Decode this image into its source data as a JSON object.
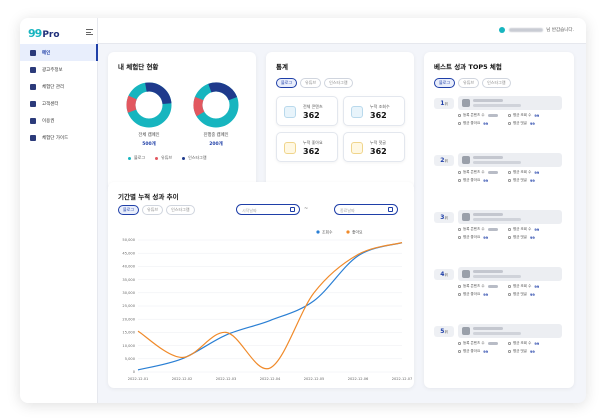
{
  "logo": {
    "num": "99",
    "pro": "Pro"
  },
  "nav": [
    {
      "label": "메인",
      "icon": "home-icon",
      "active": true
    },
    {
      "label": "광고주정보",
      "icon": "document-icon",
      "active": false
    },
    {
      "label": "체험단 관리",
      "icon": "users-icon",
      "active": false
    },
    {
      "label": "고객센터",
      "icon": "headset-icon",
      "active": false
    },
    {
      "label": "이용권",
      "icon": "ticket-icon",
      "active": false
    },
    {
      "label": "체험단 가이드",
      "icon": "book-icon",
      "active": false
    }
  ],
  "user": {
    "suffix": "님 반갑습니다."
  },
  "status": {
    "title": "내 체험단 현황",
    "donut1": {
      "label": "전체 캠페인",
      "value": "500개"
    },
    "donut2": {
      "label": "진행중 캠페인",
      "value": "200개"
    },
    "legend": [
      "블로그",
      "유튜브",
      "인스타그램"
    ]
  },
  "stats": {
    "title": "통계",
    "tabs": [
      "블로그",
      "유튜브",
      "인스타그램"
    ],
    "items": [
      {
        "label": "전체 콘텐츠",
        "value": "362",
        "icon": "content-icon"
      },
      {
        "label": "누적 조회수",
        "value": "362",
        "icon": "views-icon"
      },
      {
        "label": "누적 좋아요",
        "value": "362",
        "icon": "heart-icon"
      },
      {
        "label": "누적 댓글",
        "value": "362",
        "icon": "comment-icon"
      }
    ]
  },
  "trend": {
    "title": "기간별 누적 성과 추이",
    "tabs": [
      "블로그",
      "유튜브",
      "인스타그램"
    ],
    "date_start_placeholder": "시작날짜",
    "date_end_placeholder": "종료날짜",
    "date_sep": "~"
  },
  "top5": {
    "title": "베스트 성과 TOP5 체험",
    "tabs": [
      "블로그",
      "유튜브",
      "인스타그램"
    ],
    "rank_suffix": "위",
    "metric_labels": [
      "등록 콘텐츠 수",
      "평균 조회 수",
      "평균 좋아요",
      "평균 댓글"
    ],
    "ranks": [
      {
        "rank": "1",
        "values": [
          "",
          "99",
          "99",
          "99"
        ]
      },
      {
        "rank": "2",
        "values": [
          "",
          "99",
          "99",
          "99"
        ]
      },
      {
        "rank": "3",
        "values": [
          "",
          "99",
          "99",
          "99"
        ]
      },
      {
        "rank": "4",
        "values": [
          "",
          "99",
          "99",
          "99"
        ]
      },
      {
        "rank": "5",
        "values": [
          "",
          "99",
          "99",
          "99"
        ]
      }
    ]
  },
  "colors": {
    "accent": "#1f3fa8",
    "teal": "#17b5bf",
    "red": "#e2575f",
    "navy": "#1f3a8c",
    "blue_line": "#2a7fd4",
    "orange_line": "#f08a2a"
  },
  "chart_data": {
    "type": "line",
    "x": [
      "2022.12.01",
      "2022.12.02",
      "2022.12.03",
      "2022.12.04",
      "2022.12.05",
      "2022.12.06",
      "2022.12.07"
    ],
    "ylim": [
      0,
      50000
    ],
    "yticks": [
      "0",
      "5,000",
      "10,000",
      "15,000",
      "20,000",
      "25,000",
      "30,000",
      "35,000",
      "40,000",
      "45,000",
      "50,000"
    ],
    "series": [
      {
        "name": "조회수",
        "color": "#2a7fd4",
        "values": [
          800,
          5000,
          14000,
          19500,
          27000,
          44000,
          49000
        ]
      },
      {
        "name": "좋아요",
        "color": "#f08a2a",
        "values": [
          15500,
          5500,
          15000,
          1500,
          30000,
          44500,
          49000
        ]
      }
    ]
  }
}
